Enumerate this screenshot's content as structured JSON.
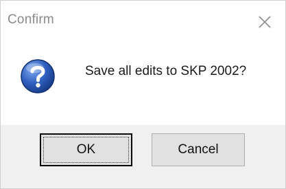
{
  "window": {
    "title": "Confirm",
    "close_icon": "close-icon"
  },
  "content": {
    "icon": "question-icon",
    "message": "Save all edits to SKP 2002?"
  },
  "buttons": {
    "ok_label": "OK",
    "cancel_label": "Cancel"
  },
  "colors": {
    "footer_background": "#f0f0f0",
    "icon_blue": "#1f4fa8",
    "button_face": "#e1e1e1"
  }
}
